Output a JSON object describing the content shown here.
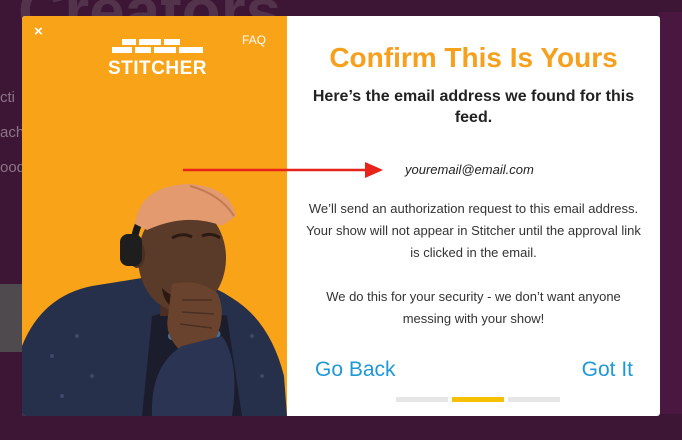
{
  "background": {
    "title": "Creators",
    "lines": [
      "cti",
      "ach",
      "ood"
    ]
  },
  "modal": {
    "close_label": "×",
    "faq_label": "FAQ",
    "logo_text": "STITCHER",
    "title": "Confirm This Is Yours",
    "subtitle": "Here’s the email address we found for this feed.",
    "email": "youremail@email.com",
    "paragraph1": "We’ll send an authorization request to this email address. Your show will not appear in Stitcher until the approval link is clicked in the email.",
    "paragraph2": "We do this for your security - we don’t want anyone messing with your show!",
    "go_back_label": "Go Back",
    "got_it_label": "Got It",
    "steps_total": 3,
    "steps_active": 2
  },
  "colors": {
    "accent_orange": "#f9a318",
    "title_orange": "#f7a01e",
    "link_blue": "#2098d6",
    "arrow_red": "#e8241a",
    "step_active": "#f5c000"
  },
  "icons": {
    "close": "close-icon",
    "arrow": "arrow-right-icon"
  }
}
